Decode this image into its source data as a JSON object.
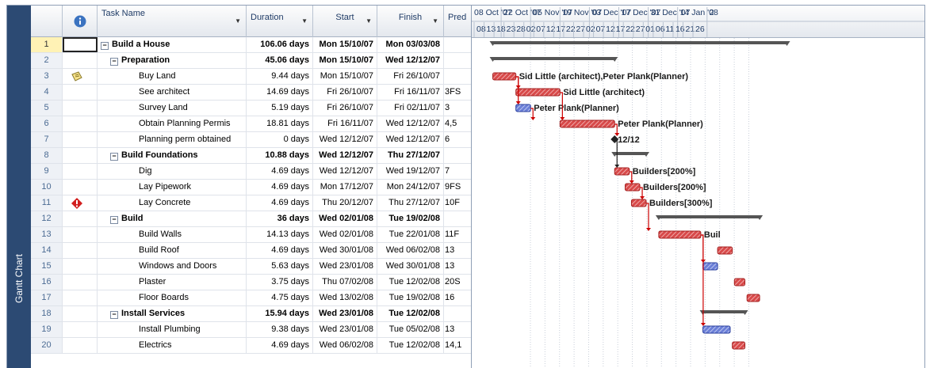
{
  "side_tab_label": "Gantt Chart",
  "columns": {
    "task_name": "Task Name",
    "duration": "Duration",
    "start": "Start",
    "finish": "Finish",
    "predecessors": "Pred"
  },
  "rows": [
    {
      "id": "1",
      "name": "Build a House",
      "duration": "106.06 days",
      "start": "Mon 15/10/07",
      "finish": "Mon 03/03/08",
      "pred": "",
      "level": 0,
      "summary": true
    },
    {
      "id": "2",
      "name": "Preparation",
      "duration": "45.06 days",
      "start": "Mon 15/10/07",
      "finish": "Wed 12/12/07",
      "pred": "",
      "level": 1,
      "summary": true
    },
    {
      "id": "3",
      "name": "Buy Land",
      "duration": "9.44 days",
      "start": "Mon 15/10/07",
      "finish": "Fri 26/10/07",
      "pred": "",
      "level": 2,
      "summary": false,
      "indicator": "note-icon"
    },
    {
      "id": "4",
      "name": "See architect",
      "duration": "14.69 days",
      "start": "Fri 26/10/07",
      "finish": "Fri 16/11/07",
      "pred": "3FS",
      "level": 2,
      "summary": false
    },
    {
      "id": "5",
      "name": "Survey Land",
      "duration": "5.19 days",
      "start": "Fri 26/10/07",
      "finish": "Fri 02/11/07",
      "pred": "3",
      "level": 2,
      "summary": false
    },
    {
      "id": "6",
      "name": "Obtain Planning Permis",
      "duration": "18.81 days",
      "start": "Fri 16/11/07",
      "finish": "Wed 12/12/07",
      "pred": "4,5",
      "level": 2,
      "summary": false
    },
    {
      "id": "7",
      "name": "Planning perm obtained",
      "duration": "0 days",
      "start": "Wed 12/12/07",
      "finish": "Wed 12/12/07",
      "pred": "6",
      "level": 2,
      "summary": false
    },
    {
      "id": "8",
      "name": "Build Foundations",
      "duration": "10.88 days",
      "start": "Wed 12/12/07",
      "finish": "Thu 27/12/07",
      "pred": "",
      "level": 1,
      "summary": true
    },
    {
      "id": "9",
      "name": "Dig",
      "duration": "4.69 days",
      "start": "Wed 12/12/07",
      "finish": "Wed 19/12/07",
      "pred": "7",
      "level": 2,
      "summary": false
    },
    {
      "id": "10",
      "name": "Lay Pipework",
      "duration": "4.69 days",
      "start": "Mon 17/12/07",
      "finish": "Mon 24/12/07",
      "pred": "9FS",
      "level": 2,
      "summary": false
    },
    {
      "id": "11",
      "name": "Lay Concrete",
      "duration": "4.69 days",
      "start": "Thu 20/12/07",
      "finish": "Thu 27/12/07",
      "pred": "10F",
      "level": 2,
      "summary": false,
      "indicator": "warning-icon"
    },
    {
      "id": "12",
      "name": "Build",
      "duration": "36 days",
      "start": "Wed 02/01/08",
      "finish": "Tue 19/02/08",
      "pred": "",
      "level": 1,
      "summary": true
    },
    {
      "id": "13",
      "name": "Build Walls",
      "duration": "14.13 days",
      "start": "Wed 02/01/08",
      "finish": "Tue 22/01/08",
      "pred": "11F",
      "level": 2,
      "summary": false
    },
    {
      "id": "14",
      "name": "Build Roof",
      "duration": "4.69 days",
      "start": "Wed 30/01/08",
      "finish": "Wed 06/02/08",
      "pred": "13",
      "level": 2,
      "summary": false
    },
    {
      "id": "15",
      "name": "Windows and Doors",
      "duration": "5.63 days",
      "start": "Wed 23/01/08",
      "finish": "Wed 30/01/08",
      "pred": "13",
      "level": 2,
      "summary": false
    },
    {
      "id": "16",
      "name": "Plaster",
      "duration": "3.75 days",
      "start": "Thu 07/02/08",
      "finish": "Tue 12/02/08",
      "pred": "20S",
      "level": 2,
      "summary": false
    },
    {
      "id": "17",
      "name": "Floor Boards",
      "duration": "4.75 days",
      "start": "Wed 13/02/08",
      "finish": "Tue 19/02/08",
      "pred": "16",
      "level": 2,
      "summary": false
    },
    {
      "id": "18",
      "name": "Install Services",
      "duration": "15.94 days",
      "start": "Wed 23/01/08",
      "finish": "Tue 12/02/08",
      "pred": "",
      "level": 1,
      "summary": true
    },
    {
      "id": "19",
      "name": "Install Plumbing",
      "duration": "9.38 days",
      "start": "Wed 23/01/08",
      "finish": "Tue 05/02/08",
      "pred": "13",
      "level": 2,
      "summary": false
    },
    {
      "id": "20",
      "name": "Electrics",
      "duration": "4.69 days",
      "start": "Wed 06/02/08",
      "finish": "Tue 12/02/08",
      "pred": "14,1",
      "level": 2,
      "summary": false
    }
  ],
  "timescale": {
    "major": [
      "08 Oct '07",
      "22 Oct '07",
      "05 Nov '07",
      "19 Nov '07",
      "03 Dec '07",
      "17 Dec '07",
      "31 Dec '07",
      "14 Jan '08",
      "2"
    ],
    "minor": [
      "08",
      "13",
      "18",
      "23",
      "28",
      "02",
      "07",
      "12",
      "17",
      "22",
      "27",
      "02",
      "07",
      "12",
      "17",
      "22",
      "27",
      "01",
      "06",
      "11",
      "16",
      "21",
      "26"
    ]
  },
  "bar_labels": {
    "r3": "Sid Little (architect),Peter Plank(Planner)",
    "r4": "Sid Little (architect)",
    "r5": "Peter Plank(Planner)",
    "r6": "Peter Plank(Planner)",
    "r7": "12/12",
    "r9": "Builders[200%]",
    "r10": "Builders[200%]",
    "r11": "Builders[300%]",
    "r13": "Buil"
  },
  "colors": {
    "summary_bar": "#555555",
    "task_bar": "#d84a4a",
    "task_bar_blue": "#6b7fd7",
    "link": "#cc0000",
    "id_column_bg": "#eef1f6",
    "selected_row_bg": "#fff2b5",
    "tab_bg": "#2c4a73"
  }
}
